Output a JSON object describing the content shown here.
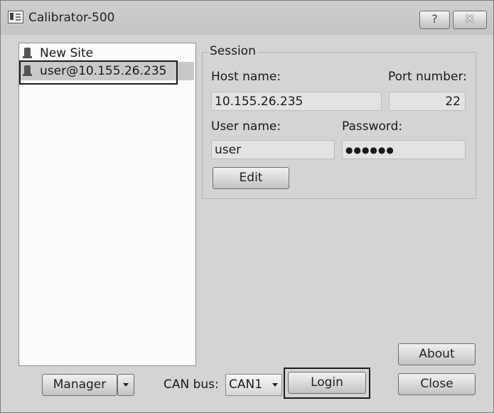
{
  "window": {
    "title": "Calibrator-500",
    "help_label": "?",
    "close_label": "✕"
  },
  "sites": [
    {
      "label": "New Site"
    },
    {
      "label": "user@10.155.26.235"
    }
  ],
  "session": {
    "group_title": "Session",
    "host_label": "Host name:",
    "host_value": "10.155.26.235",
    "port_label": "Port number:",
    "port_value": "22",
    "user_label": "User name:",
    "user_value": "user",
    "password_label": "Password:",
    "password_value": "●●●●●●",
    "edit_label": "Edit"
  },
  "footer": {
    "manager_label": "Manager",
    "canbus_label": "CAN bus:",
    "canbus_value": "CAN1",
    "login_label": "Login",
    "about_label": "About",
    "close_label": "Close"
  },
  "icons": {
    "app": "app-icon",
    "site": "server-icon",
    "dropdown": "chevron-down-icon"
  }
}
